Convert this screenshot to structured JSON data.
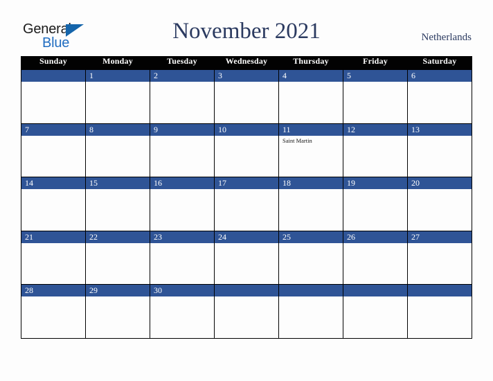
{
  "brand": {
    "name_line1": "General",
    "name_line2": "Blue",
    "triangle_icon": "triangle-icon",
    "color_dark": "#1a1a1a",
    "color_blue": "#1f6cc0",
    "triangle_color": "#1565ab"
  },
  "header": {
    "title": "November 2021",
    "country": "Netherlands",
    "title_color": "#2b3a60"
  },
  "colors": {
    "header_row_bg": "#020202",
    "header_row_text": "#ffffff",
    "date_bar_bg": "#2f5496",
    "date_bar_text": "#ffffff",
    "cell_bg": "#fdfdfd",
    "grid_line": "#000000",
    "page_bg": "#fdfdfd"
  },
  "calendar": {
    "month": "November",
    "year": "2021",
    "weekday_headers": [
      "Sunday",
      "Monday",
      "Tuesday",
      "Wednesday",
      "Thursday",
      "Friday",
      "Saturday"
    ],
    "weeks": [
      [
        {
          "date": "",
          "events": []
        },
        {
          "date": "1",
          "events": []
        },
        {
          "date": "2",
          "events": []
        },
        {
          "date": "3",
          "events": []
        },
        {
          "date": "4",
          "events": []
        },
        {
          "date": "5",
          "events": []
        },
        {
          "date": "6",
          "events": []
        }
      ],
      [
        {
          "date": "7",
          "events": []
        },
        {
          "date": "8",
          "events": []
        },
        {
          "date": "9",
          "events": []
        },
        {
          "date": "10",
          "events": []
        },
        {
          "date": "11",
          "events": [
            "Saint Martin"
          ]
        },
        {
          "date": "12",
          "events": []
        },
        {
          "date": "13",
          "events": []
        }
      ],
      [
        {
          "date": "14",
          "events": []
        },
        {
          "date": "15",
          "events": []
        },
        {
          "date": "16",
          "events": []
        },
        {
          "date": "17",
          "events": []
        },
        {
          "date": "18",
          "events": []
        },
        {
          "date": "19",
          "events": []
        },
        {
          "date": "20",
          "events": []
        }
      ],
      [
        {
          "date": "21",
          "events": []
        },
        {
          "date": "22",
          "events": []
        },
        {
          "date": "23",
          "events": []
        },
        {
          "date": "24",
          "events": []
        },
        {
          "date": "25",
          "events": []
        },
        {
          "date": "26",
          "events": []
        },
        {
          "date": "27",
          "events": []
        }
      ],
      [
        {
          "date": "28",
          "events": []
        },
        {
          "date": "29",
          "events": []
        },
        {
          "date": "30",
          "events": []
        },
        {
          "date": "",
          "events": []
        },
        {
          "date": "",
          "events": []
        },
        {
          "date": "",
          "events": []
        },
        {
          "date": "",
          "events": []
        }
      ]
    ]
  }
}
